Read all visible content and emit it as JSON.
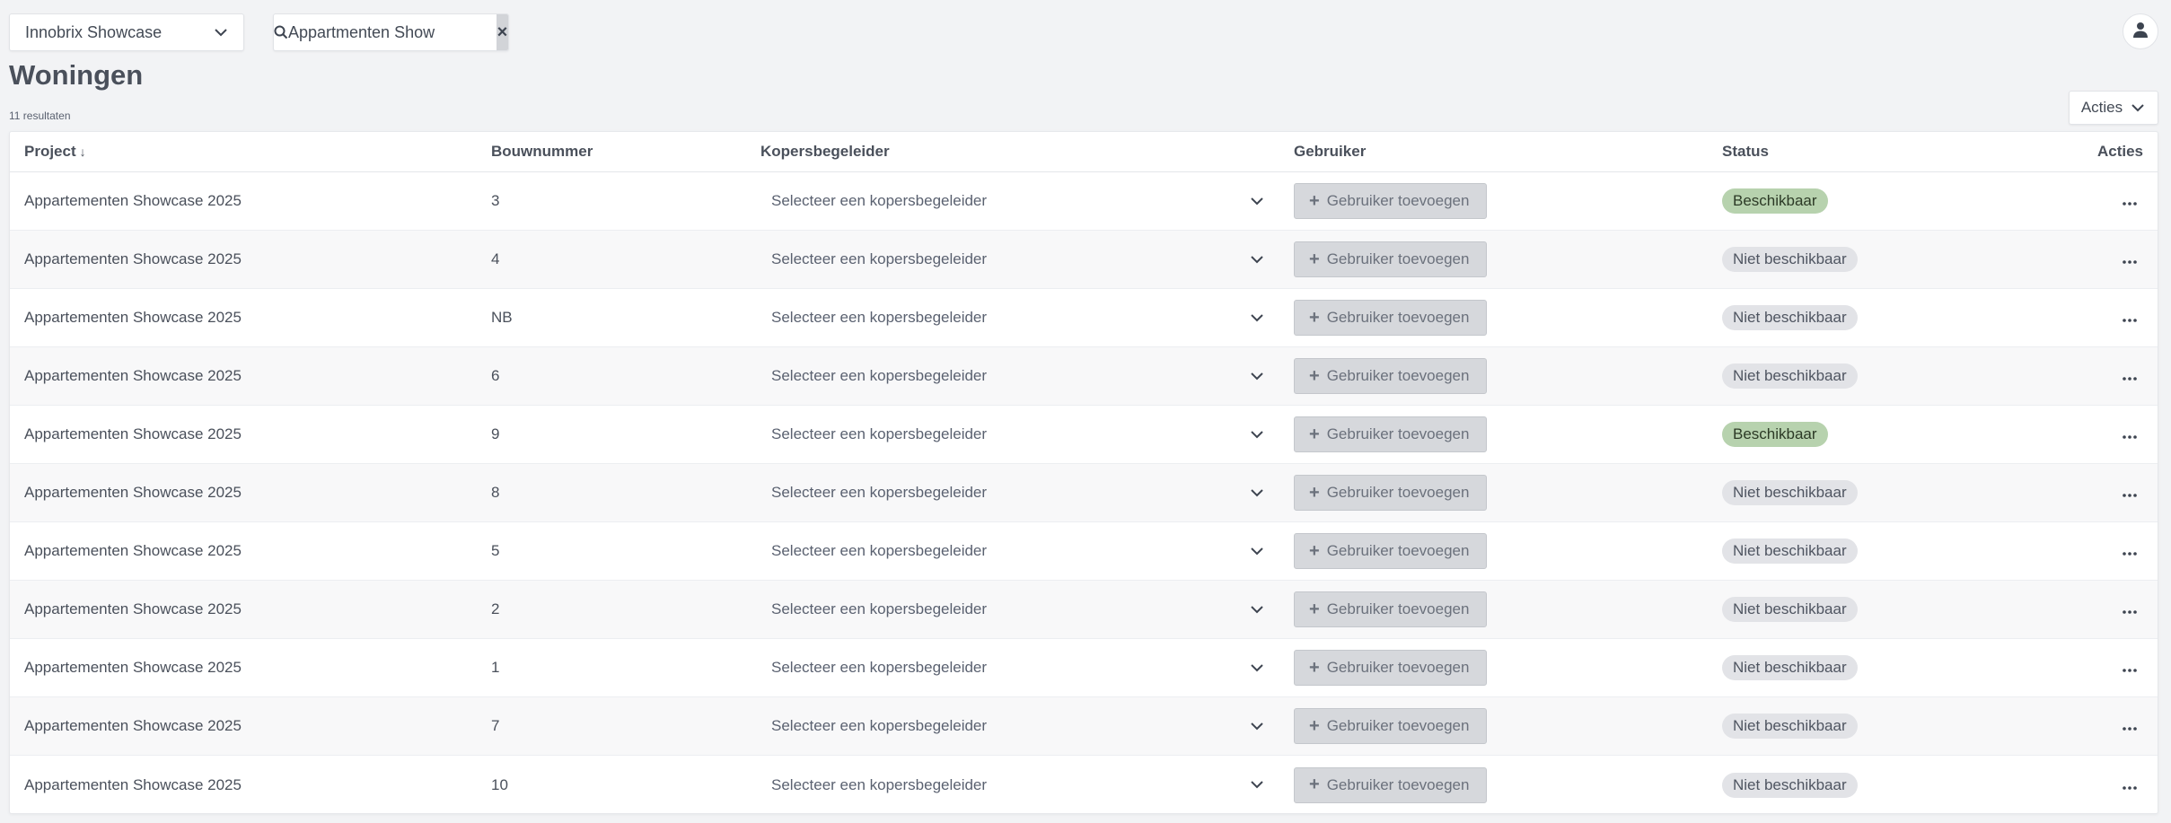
{
  "topbar": {
    "project_select": {
      "value": "Innobrix Showcase"
    },
    "search": {
      "value": "Appartmenten Show",
      "clear_symbol": "×"
    }
  },
  "page": {
    "title": "Woningen",
    "result_count": "11 resultaten",
    "actions_label": "Acties"
  },
  "table": {
    "columns": {
      "project": "Project",
      "bouwnummer": "Bouwnummer",
      "kopersbegeleider": "Kopersbegeleider",
      "gebruiker": "Gebruiker",
      "status": "Status",
      "acties": "Acties"
    },
    "sort_indicator": "↓",
    "koper_placeholder": "Selecteer een kopersbegeleider",
    "add_user_label": "Gebruiker toevoegen",
    "rows": [
      {
        "project": "Appartementen Showcase 2025",
        "bouwnummer": "3",
        "status": "Beschikbaar",
        "available": true
      },
      {
        "project": "Appartementen Showcase 2025",
        "bouwnummer": "4",
        "status": "Niet beschikbaar",
        "available": false
      },
      {
        "project": "Appartementen Showcase 2025",
        "bouwnummer": "NB",
        "status": "Niet beschikbaar",
        "available": false
      },
      {
        "project": "Appartementen Showcase 2025",
        "bouwnummer": "6",
        "status": "Niet beschikbaar",
        "available": false
      },
      {
        "project": "Appartementen Showcase 2025",
        "bouwnummer": "9",
        "status": "Beschikbaar",
        "available": true
      },
      {
        "project": "Appartementen Showcase 2025",
        "bouwnummer": "8",
        "status": "Niet beschikbaar",
        "available": false
      },
      {
        "project": "Appartementen Showcase 2025",
        "bouwnummer": "5",
        "status": "Niet beschikbaar",
        "available": false
      },
      {
        "project": "Appartementen Showcase 2025",
        "bouwnummer": "2",
        "status": "Niet beschikbaar",
        "available": false
      },
      {
        "project": "Appartementen Showcase 2025",
        "bouwnummer": "1",
        "status": "Niet beschikbaar",
        "available": false
      },
      {
        "project": "Appartementen Showcase 2025",
        "bouwnummer": "7",
        "status": "Niet beschikbaar",
        "available": false
      },
      {
        "project": "Appartementen Showcase 2025",
        "bouwnummer": "10",
        "status": "Niet beschikbaar",
        "available": false
      }
    ]
  },
  "colors": {
    "available_badge": "#b7d2ae",
    "unavailable_badge": "#e2e3e7",
    "background": "#f2f3f5"
  },
  "icons": {
    "search": "search-icon",
    "chevron": "chevron-down-icon",
    "user": "user-icon",
    "plus": "plus-icon",
    "more": "more-horizontal-icon"
  }
}
